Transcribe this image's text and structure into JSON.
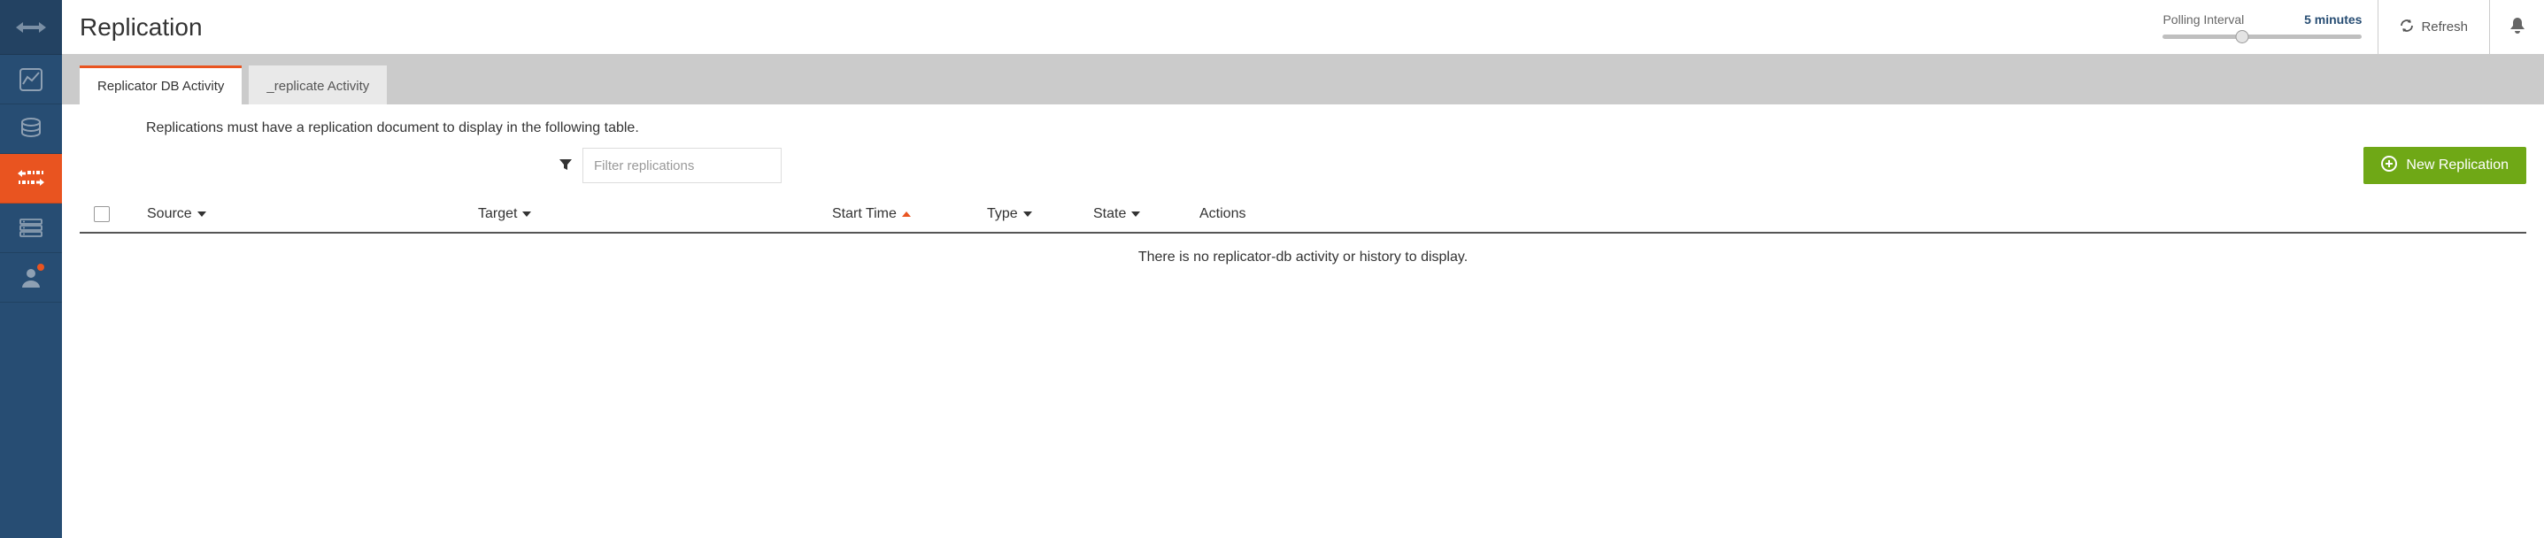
{
  "header": {
    "title": "Replication",
    "polling_label": "Polling Interval",
    "polling_value": "5 minutes",
    "refresh_label": "Refresh"
  },
  "sidebar": {
    "items": [
      {
        "name": "collapse",
        "icon": "arrows-h",
        "active": false
      },
      {
        "name": "active-tasks",
        "icon": "chart",
        "active": false
      },
      {
        "name": "databases",
        "icon": "database",
        "active": false
      },
      {
        "name": "replication",
        "icon": "replication",
        "active": true
      },
      {
        "name": "config",
        "icon": "servers",
        "active": false
      },
      {
        "name": "user",
        "icon": "user",
        "active": false,
        "notif": true
      }
    ]
  },
  "tabs": [
    {
      "label": "Replicator DB Activity",
      "active": true
    },
    {
      "label": "_replicate Activity",
      "active": false
    }
  ],
  "content": {
    "hint": "Replications must have a replication document to display in the following table.",
    "filter_placeholder": "Filter replications",
    "new_button": "New Replication",
    "empty_message": "There is no replicator-db activity or history to display."
  },
  "columns": {
    "source": "Source",
    "target": "Target",
    "start_time": "Start Time",
    "type": "Type",
    "state": "State",
    "actions": "Actions"
  }
}
